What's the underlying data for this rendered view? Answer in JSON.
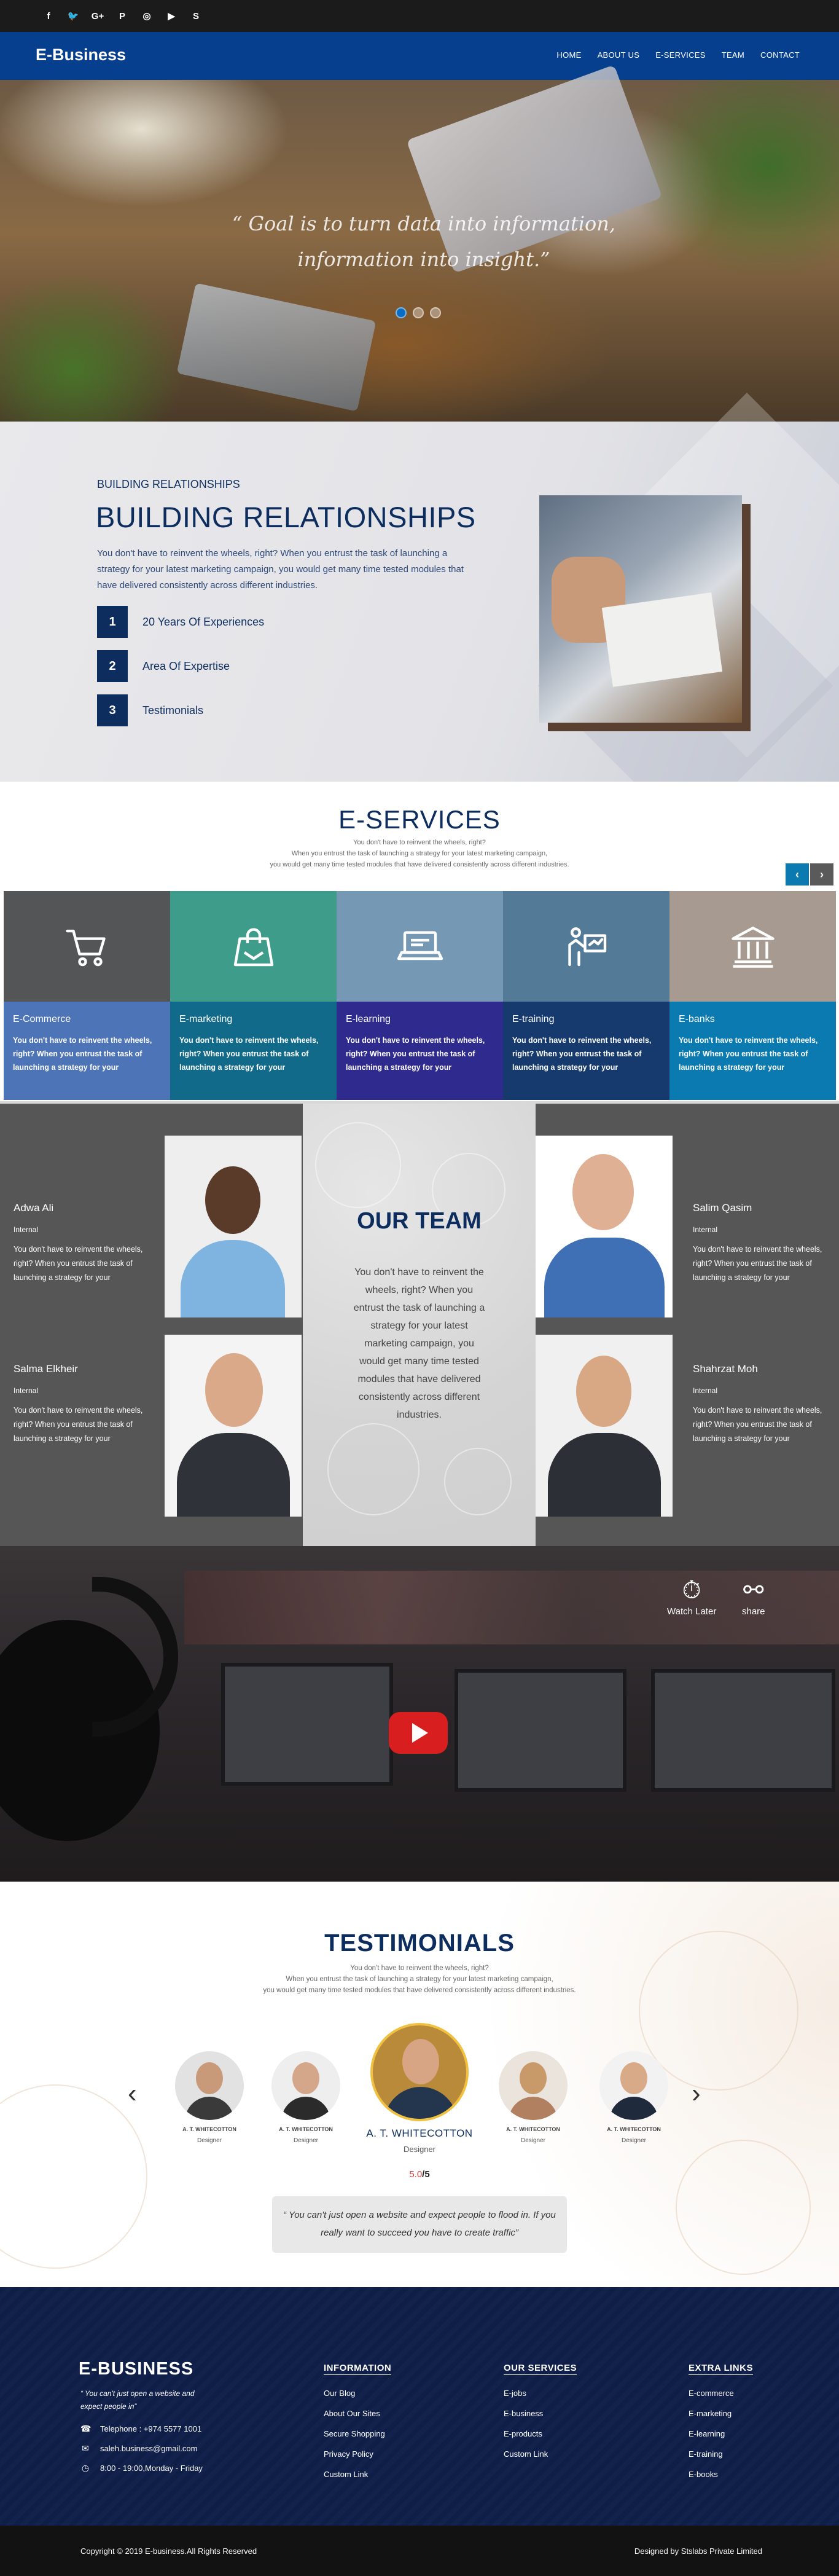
{
  "social": {
    "icons": [
      "facebook-icon",
      "twitter-icon",
      "google-plus-icon",
      "pinterest-icon",
      "instagram-icon",
      "youtube-icon",
      "skype-icon"
    ],
    "glyphs": [
      "f",
      "🐦",
      "G+",
      "P",
      "◎",
      "▶",
      "S"
    ]
  },
  "nav": {
    "brand": "E-Business",
    "links": [
      "HOME",
      "ABOUT US",
      "E-SERVICES",
      "TEAM",
      "CONTACT"
    ]
  },
  "hero": {
    "quote_line1": "“ Goal is to turn data into information,",
    "quote_line2": "information into insight.”",
    "active_slide": 1,
    "slide_count": 3
  },
  "relationships": {
    "kicker": "BUILDING RELATIONSHIPS",
    "title": "BUILDING RELATIONSHIPS",
    "text": "You don't have to reinvent the wheels, right? When you entrust the task of launching a strategy for your latest marketing campaign, you would get many time tested modules that have delivered consistently across different industries.",
    "items": [
      {
        "num": "1",
        "label": "20 Years Of Experiences"
      },
      {
        "num": "2",
        "label": "Area Of Expertise"
      },
      {
        "num": "3",
        "label": "Testimonials"
      }
    ]
  },
  "services": {
    "title": "E-SERVICES",
    "sub1": "You don't have to reinvent the wheels, right?",
    "sub2": "When you entrust the task of launching a strategy for your latest marketing campaign,",
    "sub3": "you would get many time tested modules that have delivered consistently across different industries.",
    "prev": "‹",
    "next": "›",
    "cards": [
      {
        "name": "E-Commerce",
        "icon": "shopping-cart-icon",
        "desc": "You don't have to reinvent the wheels, right? When you entrust the task of launching a strategy for your",
        "top": "#535557",
        "bottom": "#4e74b8"
      },
      {
        "name": "E-marketing",
        "icon": "shopping-bag-icon",
        "desc": "You don't have to reinvent the wheels, right? When you entrust the task of launching a strategy for your",
        "top": "#3d9c8a",
        "bottom": "#116a8a"
      },
      {
        "name": "E-learning",
        "icon": "laptop-icon",
        "desc": "You don't have to reinvent the wheels, right? When you entrust the task of launching a strategy for your",
        "top": "#7598b4",
        "bottom": "#2e2a8e"
      },
      {
        "name": "E-training",
        "icon": "presentation-icon",
        "desc": "You don't have to reinvent the wheels, right? When you entrust the task of launching a strategy for your",
        "top": "#537a96",
        "bottom": "#163a6e"
      },
      {
        "name": "E-banks",
        "icon": "bank-icon",
        "desc": "You don't have to reinvent the wheels, right? When you entrust the task of launching a strategy for your",
        "top": "#a79a90",
        "bottom": "#0a7ab0"
      }
    ]
  },
  "team": {
    "title": "OUR TEAM",
    "text": "You don't have to reinvent the wheels, right? When you entrust the task of launching a strategy for your latest marketing campaign, you would get many time tested modules that have delivered consistently across different industries.",
    "members": [
      {
        "name": "Adwa Ali",
        "role": "Internal",
        "desc": "You don't have to reinvent the wheels, right? When you entrust the task of launching a strategy for your"
      },
      {
        "name": "Salim Qasim",
        "role": "Internal",
        "desc": "You don't have to reinvent the wheels, right? When you entrust the task of launching a strategy for your"
      },
      {
        "name": "Salma Elkheir",
        "role": "Internal",
        "desc": "You don't have to reinvent the wheels, right? When you entrust the task of launching a strategy for your"
      },
      {
        "name": "Shahrzat Moh",
        "role": "Internal",
        "desc": "You don't have to reinvent the wheels, right? When you entrust the task of launching a strategy for your"
      }
    ]
  },
  "video": {
    "watch_later": "Watch Later",
    "share": "share",
    "watch_icon": "⏱",
    "share_icon": "⚯"
  },
  "testimonials": {
    "title": "TESTIMONIALS",
    "sub1": "You don't have to reinvent the wheels, right?",
    "sub2": "When you entrust the task of launching a strategy for your latest marketing campaign,",
    "sub3": "you would get many time tested modules that have delivered consistently across different industries.",
    "people": [
      {
        "name": "A. T. WHITECOTTON",
        "role": "Designer"
      },
      {
        "name": "A. T. WHITECOTTON",
        "role": "Designer"
      },
      {
        "name": "A. T. WHITECOTTON",
        "role": "Designer"
      },
      {
        "name": "A. T. WHITECOTTON",
        "role": "Designer"
      },
      {
        "name": "A. T. WHITECOTTON",
        "role": "Designer"
      }
    ],
    "rating_value": "5.0",
    "rating_max": "/5",
    "quote": "“ You can't just open a website and expect people to flood in. If you really want to succeed you have to create traffic”",
    "prev": "‹",
    "next": "›"
  },
  "footer": {
    "brand": "E-BUSINESS",
    "tagline": "“ You can't just open a website and expect people in”",
    "phone": "Telephone : +974 5577 1001",
    "email": "saleh.business@gmail.com",
    "hours": "8:00 - 19:00,Monday - Friday",
    "columns": [
      {
        "title": "INFORMATION",
        "links": [
          "Our Blog",
          "About Our Sites",
          "Secure Shopping",
          "Privacy Policy",
          "Custom Link"
        ]
      },
      {
        "title": "OUR SERVICES",
        "links": [
          "E-jobs",
          "E-business",
          "E-products",
          "Custom Link"
        ]
      },
      {
        "title": "EXTRA LINKS",
        "links": [
          "E-commerce",
          "E-marketing",
          "E-learning",
          "E-training",
          "E-books"
        ]
      }
    ],
    "copyright": "Copyright © 2019 E-business.All Rights Reserved",
    "designed_by": "Designed by Stslabs Private Limited"
  }
}
